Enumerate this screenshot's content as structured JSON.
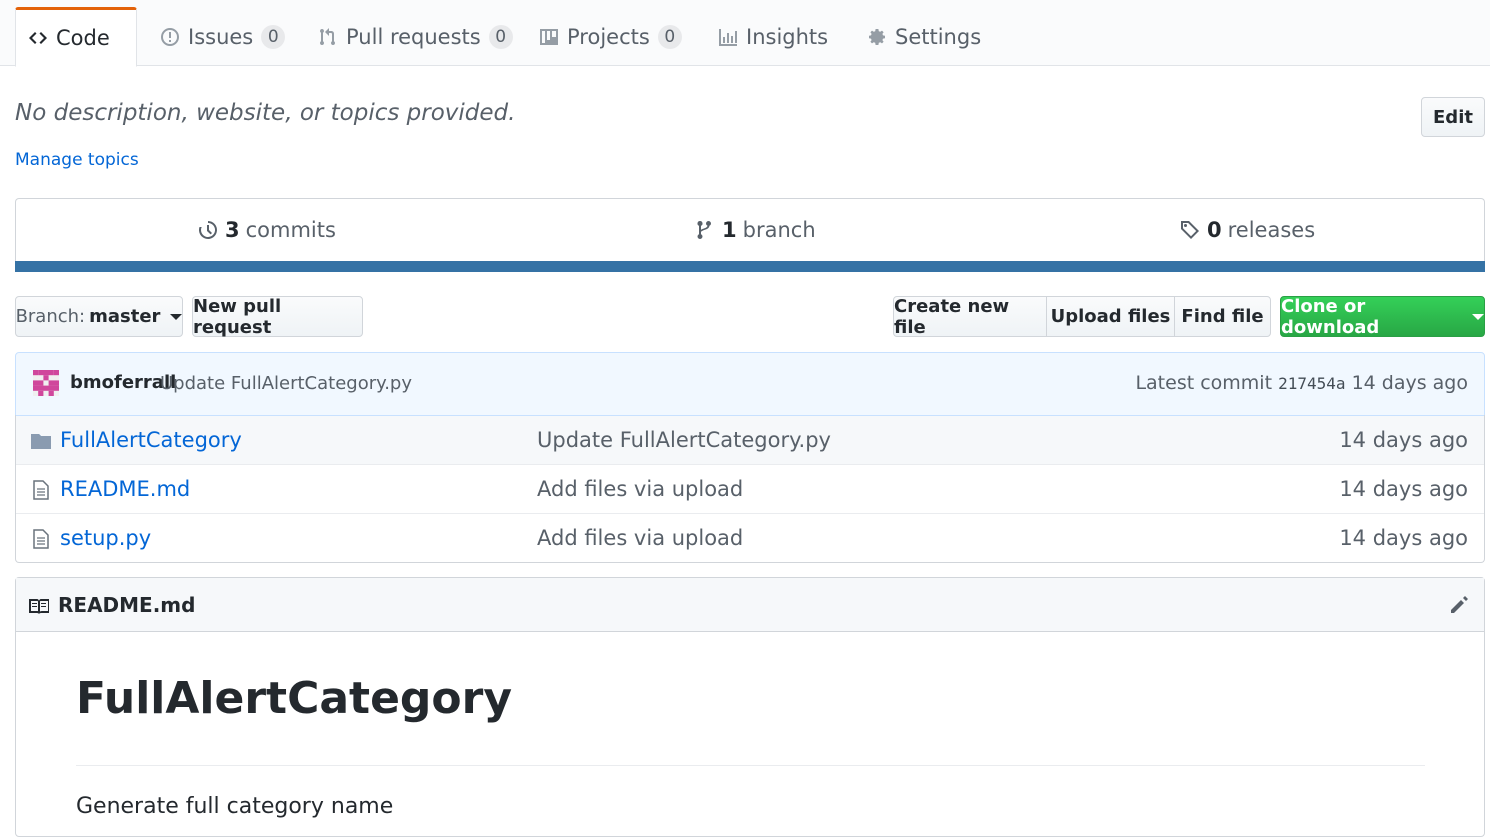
{
  "tabs": [
    {
      "label": "Code",
      "icon": "code-icon",
      "selected": true
    },
    {
      "label": "Issues",
      "icon": "issue-icon",
      "count": "0"
    },
    {
      "label": "Pull requests",
      "icon": "pull-request-icon",
      "count": "0"
    },
    {
      "label": "Projects",
      "icon": "project-icon",
      "count": "0"
    },
    {
      "label": "Insights",
      "icon": "graph-icon"
    },
    {
      "label": "Settings",
      "icon": "gear-icon"
    }
  ],
  "repo": {
    "description": "No description, website, or topics provided.",
    "manage_topics": "Manage topics",
    "edit_label": "Edit"
  },
  "summary": {
    "commits_count": "3",
    "commits_label": "commits",
    "branch_count": "1",
    "branch_label": "branch",
    "releases_count": "0",
    "releases_label": "releases",
    "language_color": "#3572a5"
  },
  "file_nav": {
    "branch_prefix": "Branch:",
    "branch_name": "master",
    "new_pull_request": "New pull request",
    "create_new_file": "Create new file",
    "upload_files": "Upload files",
    "find_file": "Find file",
    "clone_or_download": "Clone or download"
  },
  "latest_commit": {
    "author": "bmoferrall",
    "message": "Update FullAlertCategory.py",
    "label": "Latest commit",
    "sha": "217454a",
    "age": "14 days ago"
  },
  "files": [
    {
      "type": "folder",
      "name": "FullAlertCategory",
      "message": "Update FullAlertCategory.py",
      "age": "14 days ago"
    },
    {
      "type": "file",
      "name": "README.md",
      "message": "Add files via upload",
      "age": "14 days ago"
    },
    {
      "type": "file",
      "name": "setup.py",
      "message": "Add files via upload",
      "age": "14 days ago"
    }
  ],
  "readme": {
    "filename": "README.md",
    "heading": "FullAlertCategory",
    "text": "Generate full category name"
  }
}
